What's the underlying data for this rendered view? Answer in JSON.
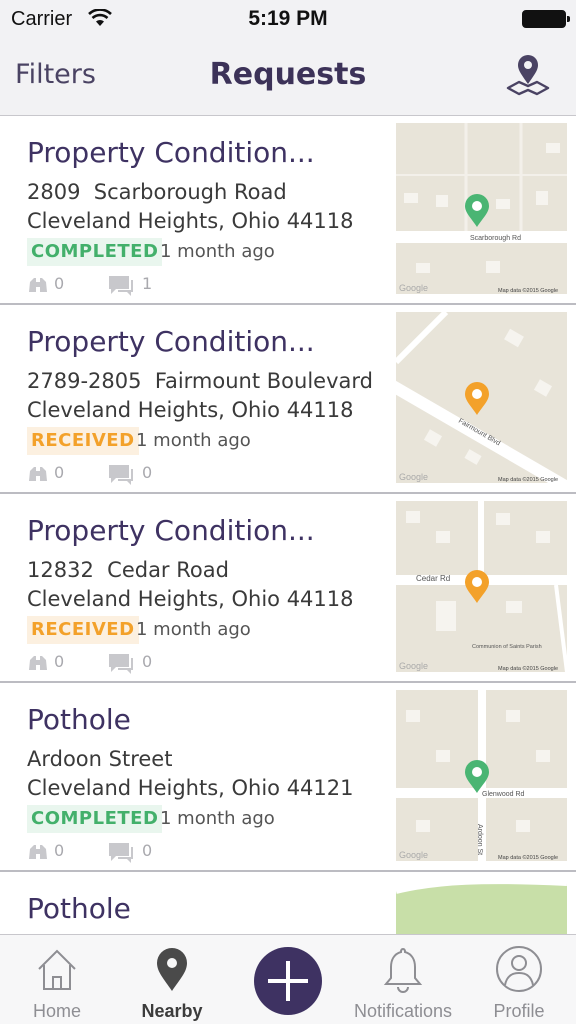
{
  "status_bar": {
    "carrier": "Carrier",
    "time": "5:19 PM"
  },
  "nav": {
    "filters_label": "Filters",
    "title": "Requests"
  },
  "requests": [
    {
      "title": "Property Condition...",
      "address_line1": "2809  Scarborough Road",
      "address_line2": "Cleveland Heights, Ohio 44118",
      "status": "COMPLETED",
      "status_color": "#43b06b",
      "time_ago": "1 month ago",
      "follows": "0",
      "comments": "1",
      "map_street": "Scarborough Rd",
      "map_attribution": "Map data ©2015 Google",
      "map_logo": "Google"
    },
    {
      "title": "Property Condition...",
      "address_line1": "2789-2805  Fairmount Boulevard",
      "address_line2": "Cleveland Heights, Ohio 44118",
      "status": "RECEIVED",
      "status_color": "#f3a12a",
      "time_ago": "1 month ago",
      "follows": "0",
      "comments": "0",
      "map_street": "Fairmount Blvd",
      "map_attribution": "Map data ©2015 Google",
      "map_logo": "Google"
    },
    {
      "title": "Property Condition...",
      "address_line1": "12832  Cedar Road",
      "address_line2": "Cleveland Heights, Ohio 44118",
      "status": "RECEIVED",
      "status_color": "#f3a12a",
      "time_ago": "1 month ago",
      "follows": "0",
      "comments": "0",
      "map_street": "Cedar Rd",
      "map_poi": "Communion of Saints Parish",
      "map_attribution": "Map data ©2015 Google",
      "map_logo": "Google"
    },
    {
      "title": "Pothole",
      "address_line1": "Ardoon Street",
      "address_line2": "Cleveland Heights, Ohio 44121",
      "status": "COMPLETED",
      "status_color": "#43b06b",
      "time_ago": "1 month ago",
      "follows": "0",
      "comments": "0",
      "map_street": "Glenwood Rd",
      "map_street2": "Ardoon St",
      "map_attribution": "Map data ©2015 Google",
      "map_logo": "Google"
    },
    {
      "title": "Pothole"
    }
  ],
  "tabs": [
    {
      "label": "Home",
      "icon": "home-icon"
    },
    {
      "label": "Nearby",
      "icon": "location-pin-icon",
      "active": true
    },
    {
      "label": "",
      "icon": "plus-icon"
    },
    {
      "label": "Notifications",
      "icon": "bell-icon"
    },
    {
      "label": "Profile",
      "icon": "profile-icon"
    }
  ],
  "colors": {
    "brand": "#3e3262",
    "completed": "#43b06b",
    "received": "#f3a12a",
    "bar_background": "#f2f2f4"
  }
}
